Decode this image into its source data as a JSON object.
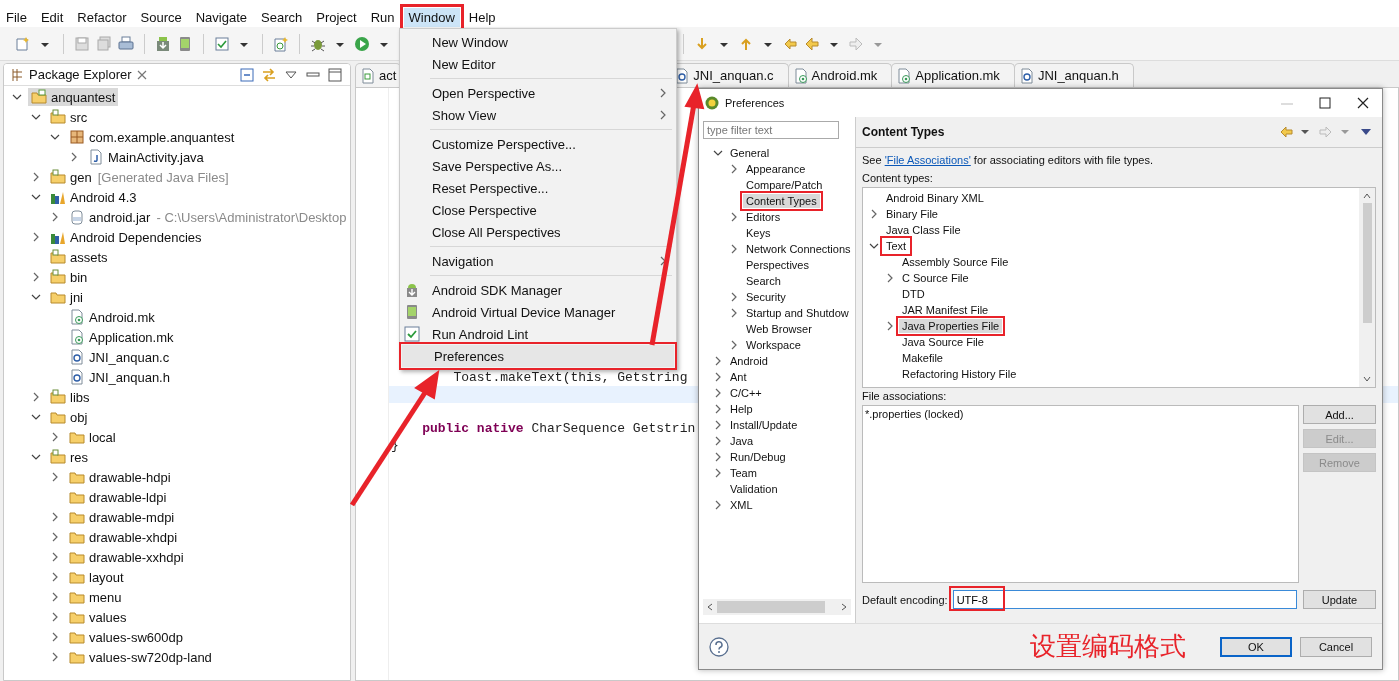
{
  "menubar": [
    {
      "label": "File",
      "selected": false,
      "highlighted": false
    },
    {
      "label": "Edit",
      "selected": false,
      "highlighted": false
    },
    {
      "label": "Refactor",
      "selected": false,
      "highlighted": false
    },
    {
      "label": "Source",
      "selected": false,
      "highlighted": false
    },
    {
      "label": "Navigate",
      "selected": false,
      "highlighted": false
    },
    {
      "label": "Search",
      "selected": false,
      "highlighted": false
    },
    {
      "label": "Project",
      "selected": false,
      "highlighted": false
    },
    {
      "label": "Run",
      "selected": false,
      "highlighted": false
    },
    {
      "label": "Window",
      "selected": true,
      "highlighted": true
    },
    {
      "label": "Help",
      "selected": false,
      "highlighted": false
    }
  ],
  "window_menu": [
    {
      "kind": "item",
      "label": "New Window",
      "submenu": false,
      "icon": false,
      "highlighted": false
    },
    {
      "kind": "item",
      "label": "New Editor",
      "submenu": false,
      "icon": false,
      "highlighted": false
    },
    {
      "kind": "separator"
    },
    {
      "kind": "item",
      "label": "Open Perspective",
      "submenu": true,
      "icon": false,
      "highlighted": false
    },
    {
      "kind": "item",
      "label": "Show View",
      "submenu": true,
      "icon": false,
      "highlighted": false
    },
    {
      "kind": "separator"
    },
    {
      "kind": "item",
      "label": "Customize Perspective...",
      "submenu": false,
      "icon": false,
      "highlighted": false
    },
    {
      "kind": "item",
      "label": "Save Perspective As...",
      "submenu": false,
      "icon": false,
      "highlighted": false
    },
    {
      "kind": "item",
      "label": "Reset Perspective...",
      "submenu": false,
      "icon": false,
      "highlighted": false
    },
    {
      "kind": "item",
      "label": "Close Perspective",
      "submenu": false,
      "icon": false,
      "highlighted": false
    },
    {
      "kind": "item",
      "label": "Close All Perspectives",
      "submenu": false,
      "icon": false,
      "highlighted": false
    },
    {
      "kind": "separator"
    },
    {
      "kind": "item",
      "label": "Navigation",
      "submenu": true,
      "icon": false,
      "highlighted": false
    },
    {
      "kind": "separator"
    },
    {
      "kind": "item",
      "label": "Android SDK Manager",
      "submenu": false,
      "icon": true,
      "highlighted": false
    },
    {
      "kind": "item",
      "label": "Android Virtual Device Manager",
      "submenu": false,
      "icon": true,
      "highlighted": false
    },
    {
      "kind": "item",
      "label": "Run Android Lint",
      "submenu": false,
      "icon": true,
      "highlighted": false
    },
    {
      "kind": "item",
      "label": "Preferences",
      "submenu": false,
      "icon": false,
      "highlighted": true
    }
  ],
  "package_explorer": {
    "title": "Package Explorer",
    "tree": [
      {
        "label": "anquantest",
        "kind": "project",
        "expanded": true,
        "selected": true,
        "children": [
          {
            "label": "src",
            "kind": "source-folder",
            "expanded": true,
            "selected": false,
            "children": [
              {
                "label": "com.example.anquantest",
                "kind": "package",
                "expanded": true,
                "selected": false,
                "children": [
                  {
                    "label": "MainActivity.java",
                    "kind": "java-file",
                    "expanded": false,
                    "selected": false
                  }
                ]
              }
            ]
          },
          {
            "label": "gen",
            "decoration": "[Generated Java Files]",
            "kind": "source-folder",
            "expanded": false,
            "selected": false
          },
          {
            "label": "Android 4.3",
            "kind": "library",
            "expanded": true,
            "selected": false,
            "children": [
              {
                "label": "android.jar",
                "decoration": "- C:\\Users\\Administrator\\Desktop",
                "kind": "jar",
                "expanded": false,
                "selected": false
              }
            ]
          },
          {
            "label": "Android Dependencies",
            "kind": "library",
            "expanded": false,
            "selected": false
          },
          {
            "label": "assets",
            "kind": "source-folder",
            "selected": false
          },
          {
            "label": "bin",
            "kind": "source-folder",
            "expanded": false,
            "selected": false
          },
          {
            "label": "jni",
            "kind": "folder",
            "expanded": true,
            "selected": false,
            "children": [
              {
                "label": "Android.mk",
                "kind": "makefile",
                "selected": false
              },
              {
                "label": "Application.mk",
                "kind": "makefile",
                "selected": false
              },
              {
                "label": "JNI_anquan.c",
                "kind": "c-file",
                "selected": false
              },
              {
                "label": "JNI_anquan.h",
                "kind": "c-file",
                "selected": false
              }
            ]
          },
          {
            "label": "libs",
            "kind": "source-folder",
            "expanded": false,
            "selected": false
          },
          {
            "label": "obj",
            "kind": "folder",
            "expanded": true,
            "selected": false,
            "children": [
              {
                "label": "local",
                "kind": "folder",
                "expanded": false,
                "selected": false
              }
            ]
          },
          {
            "label": "res",
            "kind": "source-folder",
            "expanded": true,
            "selected": false,
            "children": [
              {
                "label": "drawable-hdpi",
                "kind": "folder",
                "expanded": false,
                "selected": false
              },
              {
                "label": "drawable-ldpi",
                "kind": "folder",
                "selected": false
              },
              {
                "label": "drawable-mdpi",
                "kind": "folder",
                "expanded": false,
                "selected": false
              },
              {
                "label": "drawable-xhdpi",
                "kind": "folder",
                "expanded": false,
                "selected": false
              },
              {
                "label": "drawable-xxhdpi",
                "kind": "folder",
                "expanded": false,
                "selected": false
              },
              {
                "label": "layout",
                "kind": "folder",
                "expanded": false,
                "selected": false
              },
              {
                "label": "menu",
                "kind": "folder",
                "expanded": false,
                "selected": false
              },
              {
                "label": "values",
                "kind": "folder",
                "expanded": false,
                "selected": false
              },
              {
                "label": "values-sw600dp",
                "kind": "folder",
                "expanded": false,
                "selected": false
              },
              {
                "label": "values-sw720dp-land",
                "kind": "folder",
                "expanded": false,
                "selected": false
              }
            ]
          }
        ]
      }
    ]
  },
  "editor": {
    "tabs": [
      {
        "label": "act",
        "kind": "layout",
        "selected": false
      },
      {
        "label": "JNI_anquan.c",
        "kind": "source",
        "selected": false
      },
      {
        "label": "Android.mk",
        "kind": "make",
        "selected": false
      },
      {
        "label": "Application.mk",
        "kind": "make",
        "selected": false
      },
      {
        "label": "JNI_anquan.h",
        "kind": "source",
        "selected": false
      }
    ],
    "lines": [
      {
        "text": "        Toast.makeText(this, Getstring",
        "current": false
      },
      {
        "text": "    **public native** CharSequence Getstrin",
        "current": false
      },
      {
        "text": "}",
        "current": false
      }
    ]
  },
  "preferences_dialog": {
    "title": "Preferences",
    "filter": {
      "placeholder": "type filter text"
    },
    "tree": [
      {
        "label": "General",
        "expanded": true,
        "selected": false,
        "highlighted": false,
        "children": [
          {
            "label": "Appearance",
            "expanded": false,
            "selected": false,
            "highlighted": false
          },
          {
            "label": "Compare/Patch",
            "selected": false,
            "highlighted": false
          },
          {
            "label": "Content Types",
            "selected": true,
            "highlighted": true
          },
          {
            "label": "Editors",
            "expanded": false,
            "selected": false,
            "highlighted": false
          },
          {
            "label": "Keys",
            "selected": false,
            "highlighted": false
          },
          {
            "label": "Network Connections",
            "expanded": false,
            "selected": false,
            "highlighted": false
          },
          {
            "label": "Perspectives",
            "selected": false,
            "highlighted": false
          },
          {
            "label": "Search",
            "selected": false,
            "highlighted": false
          },
          {
            "label": "Security",
            "expanded": false,
            "selected": false,
            "highlighted": false
          },
          {
            "label": "Startup and Shutdow",
            "expanded": false,
            "selected": false,
            "highlighted": false
          },
          {
            "label": "Web Browser",
            "selected": false,
            "highlighted": false
          },
          {
            "label": "Workspace",
            "expanded": false,
            "selected": false,
            "highlighted": false
          }
        ]
      },
      {
        "label": "Android",
        "expanded": false,
        "selected": false,
        "highlighted": false
      },
      {
        "label": "Ant",
        "expanded": false,
        "selected": false,
        "highlighted": false
      },
      {
        "label": "C/C++",
        "expanded": false,
        "selected": false,
        "highlighted": false
      },
      {
        "label": "Help",
        "expanded": false,
        "selected": false,
        "highlighted": false
      },
      {
        "label": "Install/Update",
        "expanded": false,
        "selected": false,
        "highlighted": false
      },
      {
        "label": "Java",
        "expanded": false,
        "selected": false,
        "highlighted": false
      },
      {
        "label": "Run/Debug",
        "expanded": false,
        "selected": false,
        "highlighted": false
      },
      {
        "label": "Team",
        "expanded": false,
        "selected": false,
        "highlighted": false
      },
      {
        "label": "Validation",
        "selected": false,
        "highlighted": false
      },
      {
        "label": "XML",
        "expanded": false,
        "selected": false,
        "highlighted": false
      }
    ],
    "page_title": "Content Types",
    "description": {
      "before": "See ",
      "link": "'File Associations'",
      "after": " for associating editors with file types."
    },
    "content_types_label": "Content types:",
    "content_types": [
      {
        "label": "Android Binary XML",
        "selected": false,
        "highlighted": false
      },
      {
        "label": "Binary File",
        "expanded": false,
        "selected": false,
        "highlighted": false
      },
      {
        "label": "Java Class File",
        "selected": false,
        "highlighted": false
      },
      {
        "label": "Text",
        "expanded": true,
        "selected": false,
        "highlighted": true,
        "children": [
          {
            "label": "Assembly Source File",
            "selected": false,
            "highlighted": false
          },
          {
            "label": "C Source File",
            "expanded": false,
            "selected": false,
            "highlighted": false
          },
          {
            "label": "DTD",
            "selected": false,
            "highlighted": false
          },
          {
            "label": "JAR Manifest File",
            "selected": false,
            "highlighted": false
          },
          {
            "label": "Java Properties File",
            "expanded": false,
            "selected": true,
            "highlighted": true
          },
          {
            "label": "Java Source File",
            "selected": false,
            "highlighted": false
          },
          {
            "label": "Makefile",
            "selected": false,
            "highlighted": false
          },
          {
            "label": "Refactoring History File",
            "selected": false,
            "highlighted": false
          }
        ]
      }
    ],
    "file_associations_label": "File associations:",
    "file_associations": [
      "*.properties (locked)"
    ],
    "association_buttons": [
      {
        "label": "Add...",
        "disabled": false
      },
      {
        "label": "Edit...",
        "disabled": true
      },
      {
        "label": "Remove",
        "disabled": true
      }
    ],
    "encoding": {
      "label": "Default encoding:",
      "value": "UTF-8",
      "highlighted": true
    },
    "update_button": "Update",
    "annotation_caption": "设置编码格式",
    "buttons": [
      {
        "label": "OK",
        "default": true
      },
      {
        "label": "Cancel",
        "default": false
      }
    ]
  }
}
